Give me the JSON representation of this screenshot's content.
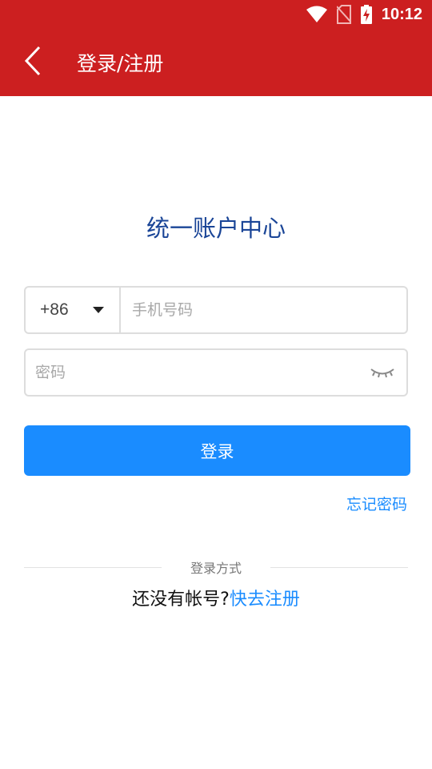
{
  "status_bar": {
    "time": "10:12",
    "icons": [
      "wifi-icon",
      "no-sim-icon",
      "battery-charging-icon"
    ]
  },
  "app_bar": {
    "back_icon": "chevron-left-icon",
    "title": "登录/注册"
  },
  "page": {
    "heading": "统一账户中心"
  },
  "phone_field": {
    "country_code": "+86",
    "dropdown_icon": "caret-down-icon",
    "placeholder": "手机号码",
    "value": ""
  },
  "password_field": {
    "placeholder": "密码",
    "value": "",
    "visibility_icon": "closed-eye-icon"
  },
  "login_button": {
    "label": "登录",
    "color": "#1a8cff"
  },
  "forgot_password": {
    "label": "忘记密码"
  },
  "divider": {
    "label": "登录方式"
  },
  "register": {
    "prompt": "还没有帐号?",
    "link": "快去注册"
  },
  "colors": {
    "brand_red": "#cc1f20",
    "heading_blue": "#1a4597",
    "accent_blue": "#1a8cff"
  }
}
